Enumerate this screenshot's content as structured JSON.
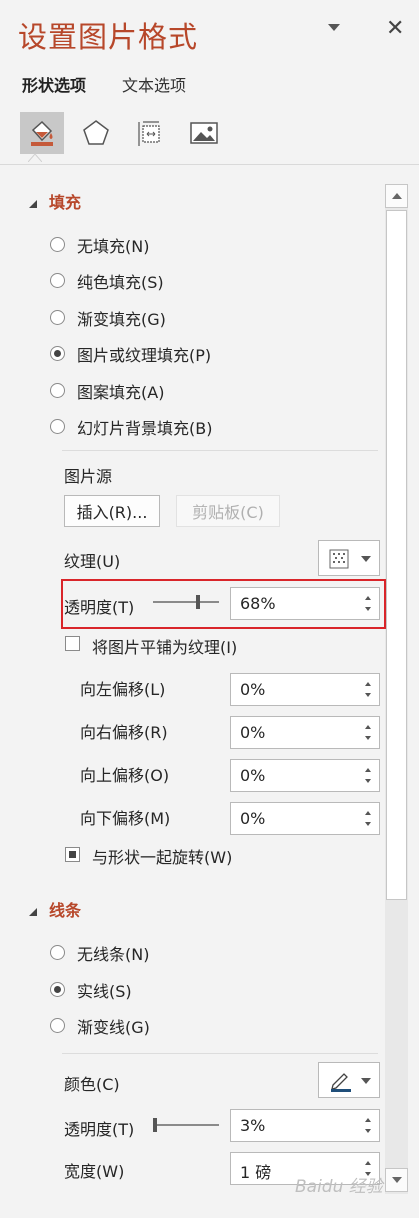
{
  "header": {
    "title": "设置图片格式",
    "close_glyph": "✕"
  },
  "tabs": [
    {
      "label": "形状选项",
      "active": true
    },
    {
      "label": "文本选项",
      "active": false
    }
  ],
  "tool_icons": [
    "fill-line-icon",
    "effects-pentagon-icon",
    "size-properties-icon",
    "picture-icon"
  ],
  "fill": {
    "title": "填充",
    "options": [
      "无填充(N)",
      "纯色填充(S)",
      "渐变填充(G)",
      "图片或纹理填充(P)",
      "图案填充(A)",
      "幻灯片背景填充(B)"
    ],
    "selected_index": 3,
    "picture_source_label": "图片源",
    "insert_button": "插入(R)...",
    "clipboard_button": "剪贴板(C)",
    "texture_label": "纹理(U)",
    "transparency_label": "透明度(T)",
    "transparency_value": "68%",
    "transparency_fraction": 0.68,
    "tile_label": "将图片平铺为纹理(I)",
    "tile_checked": false,
    "offsets": [
      {
        "label": "向左偏移(L)",
        "value": "0%"
      },
      {
        "label": "向右偏移(R)",
        "value": "0%"
      },
      {
        "label": "向上偏移(O)",
        "value": "0%"
      },
      {
        "label": "向下偏移(M)",
        "value": "0%"
      }
    ],
    "rotate_label": "与形状一起旋转(W)",
    "rotate_checked": true
  },
  "line": {
    "title": "线条",
    "options": [
      "无线条(N)",
      "实线(S)",
      "渐变线(G)"
    ],
    "selected_index": 1,
    "color_label": "颜色(C)",
    "transparency_label": "透明度(T)",
    "transparency_value": "3%",
    "transparency_fraction": 0.03,
    "width_label": "宽度(W)",
    "width_value": "1 磅"
  },
  "watermark": "Bai&#8203;du 经验",
  "colors": {
    "accent": "#b7472a",
    "highlight": "#d9252a",
    "line_color": "#1f4e79"
  }
}
